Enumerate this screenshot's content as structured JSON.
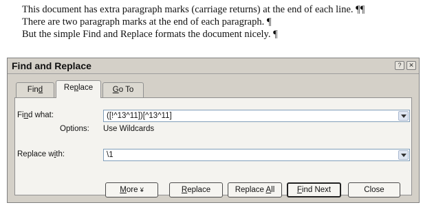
{
  "document": {
    "lines": [
      "This document has extra paragraph marks (carriage returns) at the end of each line. ¶¶",
      "There are two paragraph marks at the end of each paragraph. ¶",
      "But the simple Find and Replace formats the document nicely. ¶"
    ]
  },
  "dialog": {
    "title": "Find and Replace",
    "help_glyph": "?",
    "close_glyph": "✕",
    "tabs": [
      {
        "pre": "Fin",
        "key": "d",
        "post": ""
      },
      {
        "pre": "Re",
        "key": "p",
        "post": "lace"
      },
      {
        "pre": "",
        "key": "G",
        "post": "o To"
      }
    ],
    "active_tab": "Replace",
    "find": {
      "label_pre": "Fi",
      "label_key": "n",
      "label_post": "d what:",
      "value": "([!^13^11])[^13^11]"
    },
    "options": {
      "label": "Options:",
      "value": "Use Wildcards"
    },
    "replace": {
      "label_pre": "Replace w",
      "label_key": "i",
      "label_post": "th:",
      "value": "\\1"
    },
    "buttons": {
      "more": {
        "key": "M",
        "post": "ore",
        "arrow": "¥"
      },
      "replace": {
        "key": "R",
        "post": "eplace"
      },
      "replace_all": {
        "pre": "Replace ",
        "key": "A",
        "post": "ll"
      },
      "find_next": {
        "key": "F",
        "post": "ind Next"
      },
      "close": {
        "label": "Close"
      }
    }
  }
}
